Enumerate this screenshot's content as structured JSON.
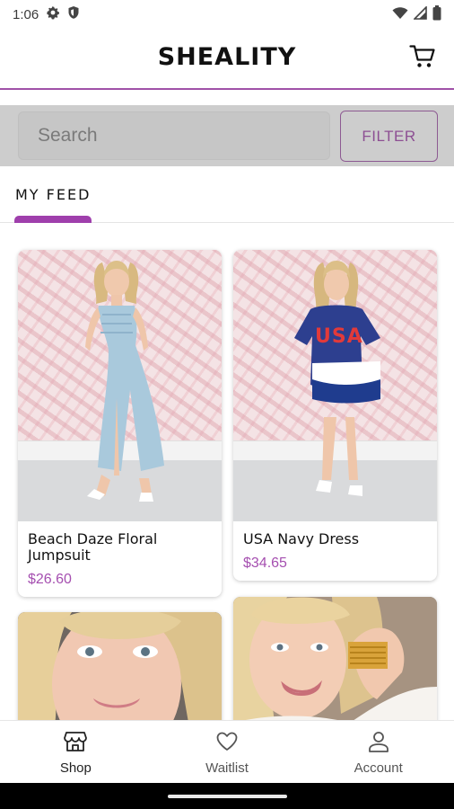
{
  "status_bar": {
    "time": "1:06",
    "icons": [
      "gear-icon",
      "shield-icon",
      "wifi-icon",
      "signal-icon",
      "battery-icon"
    ]
  },
  "header": {
    "brand": "SHEALITY",
    "cart_icon": "cart-icon",
    "accent_color": "#a052a8"
  },
  "search": {
    "placeholder": "Search",
    "value": "",
    "filter_label": "FILTER"
  },
  "tabs": [
    {
      "label": "MY FEED",
      "selected": true
    }
  ],
  "products": [
    {
      "title": "Beach Daze Floral Jumpsuit",
      "price": "$26.60"
    },
    {
      "title": "USA Navy Dress",
      "price": "$34.65"
    },
    {
      "title": "",
      "price": ""
    },
    {
      "title": "",
      "price": ""
    }
  ],
  "shirt_text": "USA",
  "price_color": "#a54fb0",
  "bottom_nav": [
    {
      "label": "Shop",
      "icon": "store-icon",
      "selected": true
    },
    {
      "label": "Waitlist",
      "icon": "heart-icon",
      "selected": false
    },
    {
      "label": "Account",
      "icon": "person-icon",
      "selected": false
    }
  ]
}
